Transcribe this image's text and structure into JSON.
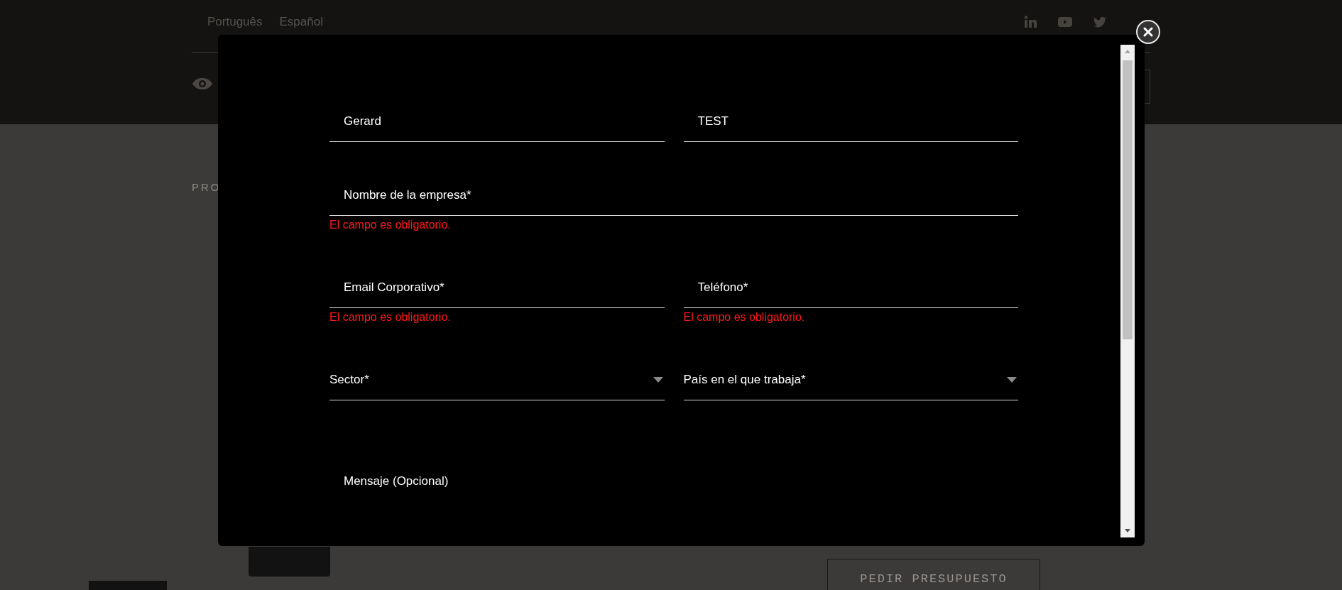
{
  "page": {
    "languages": [
      {
        "label": "Português"
      },
      {
        "label": "Español"
      }
    ],
    "breadcrumb": "PRO",
    "quote_button": "PEDIR PRESUPUESTO"
  },
  "modal": {
    "rows": [
      [
        {
          "kind": "input",
          "value": "Gerard"
        },
        {
          "kind": "input",
          "value": "TEST"
        }
      ],
      [
        {
          "kind": "input",
          "placeholder": "Nombre de la empresa*",
          "error": "El campo es obligatorio."
        }
      ],
      [
        {
          "kind": "input",
          "placeholder": "Email Corporativo*",
          "error": "El campo es obligatorio."
        },
        {
          "kind": "input",
          "placeholder": "Teléfono*",
          "error": "El campo es obligatorio."
        }
      ],
      [
        {
          "kind": "select",
          "label": "Sector*"
        },
        {
          "kind": "select",
          "label": "País en el que trabaja*"
        }
      ],
      [
        {
          "kind": "textarea",
          "placeholder": "Mensaje (Opcional)"
        }
      ]
    ]
  }
}
